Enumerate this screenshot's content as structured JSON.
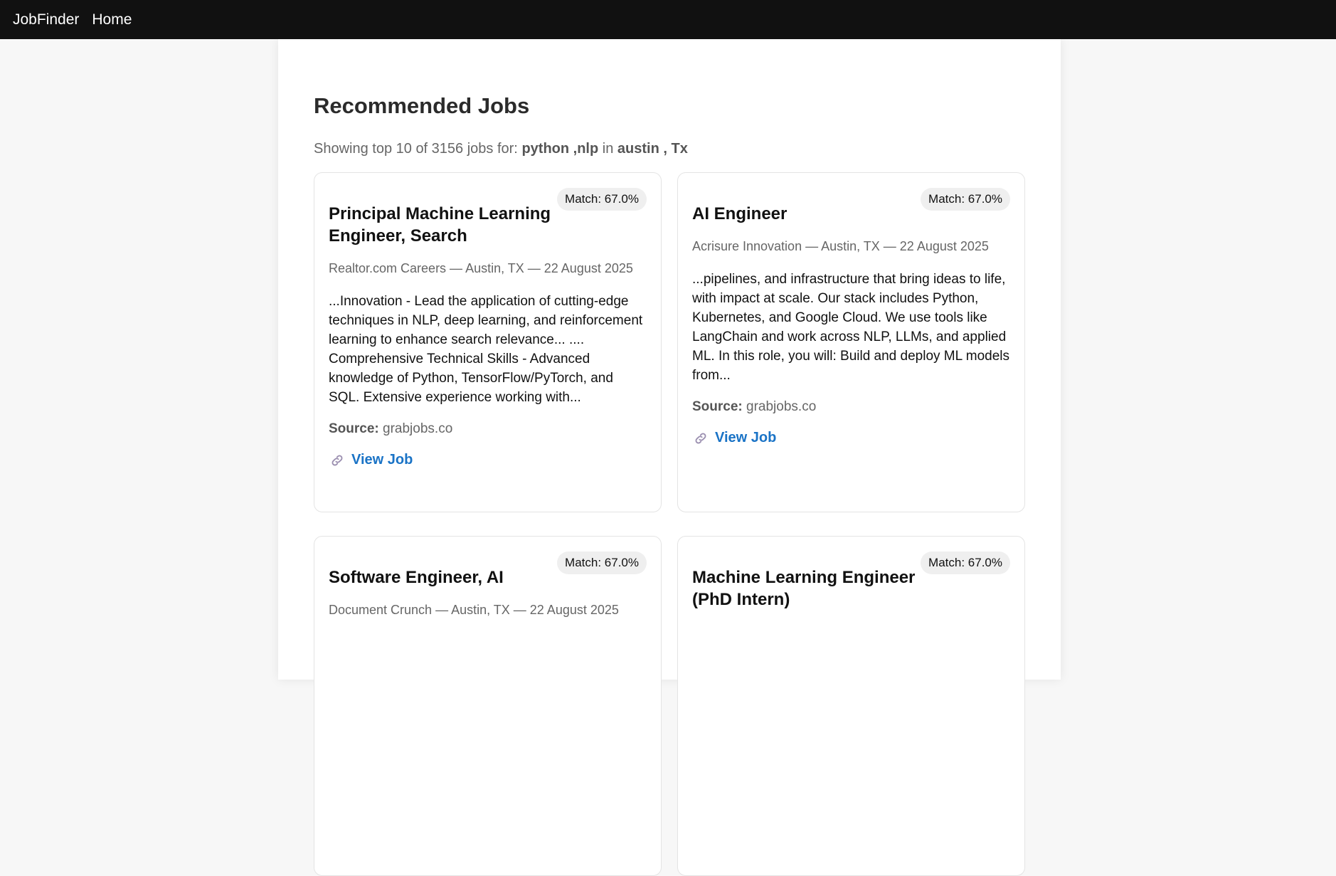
{
  "nav": {
    "brand": "JobFinder",
    "home": "Home"
  },
  "page": {
    "title": "Recommended Jobs",
    "summary_prefix": "Showing top 10 of 3156 jobs for:",
    "query": "python ,nlp",
    "summary_in": "in",
    "location": "austin , Tx"
  },
  "labels": {
    "source": "Source:",
    "view_job": "View Job",
    "link_icon": "link-icon"
  },
  "colors": {
    "navbar": "#111111",
    "link": "#1a73c6",
    "badge_bg": "#efefef"
  },
  "jobs": [
    {
      "match": "Match: 67.0%",
      "title": "Principal Machine Learning Engineer, Search",
      "meta": "Realtor.com Careers — Austin, TX — 22 August 2025",
      "description": "...Innovation - Lead the application of cutting-edge techniques in NLP, deep learning, and reinforcement learning to enhance search relevance...  .... Comprehensive Technical Skills - Advanced knowledge of Python, TensorFlow/PyTorch, and SQL. Extensive experience working with...",
      "source": "grabjobs.co"
    },
    {
      "match": "Match: 67.0%",
      "title": "AI Engineer",
      "meta": "Acrisure Innovation — Austin, TX — 22 August 2025",
      "description": "...pipelines, and infrastructure that bring ideas to life, with impact at scale. Our stack includes Python, Kubernetes, and Google Cloud. We use tools like LangChain and work across NLP, LLMs, and applied ML. In this role, you will: Build and deploy ML models from...",
      "source": "grabjobs.co"
    },
    {
      "match": "Match: 67.0%",
      "title": "Software Engineer, AI",
      "meta": "Document Crunch — Austin, TX — 22 August 2025",
      "description": "",
      "source": ""
    },
    {
      "match": "Match: 67.0%",
      "title": "Machine Learning Engineer (PhD Intern)",
      "meta": "",
      "description": "",
      "source": ""
    }
  ]
}
